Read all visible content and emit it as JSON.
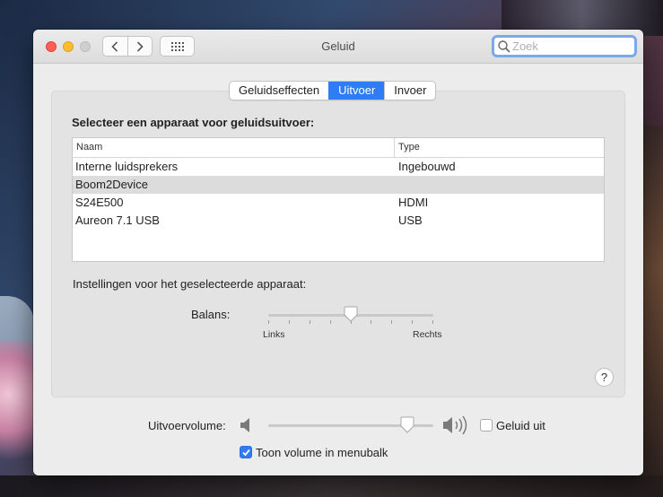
{
  "window": {
    "title": "Geluid"
  },
  "search": {
    "placeholder": "Zoek",
    "value": ""
  },
  "tabs": [
    {
      "label": "Geluidseffecten",
      "active": false
    },
    {
      "label": "Uitvoer",
      "active": true
    },
    {
      "label": "Invoer",
      "active": false
    }
  ],
  "output": {
    "heading": "Selecteer een apparaat voor geluidsuitvoer:",
    "columns": {
      "name": "Naam",
      "type": "Type"
    },
    "devices": [
      {
        "name": "Interne luidsprekers",
        "type": "Ingebouwd",
        "selected": false
      },
      {
        "name": "Boom2Device",
        "type": "",
        "selected": true
      },
      {
        "name": "S24E500",
        "type": "HDMI",
        "selected": false
      },
      {
        "name": "Aureon 7.1 USB",
        "type": "USB",
        "selected": false
      }
    ],
    "settings_label": "Instellingen voor het geselecteerde apparaat:",
    "balance": {
      "label": "Balans:",
      "left": "Links",
      "right": "Rechts",
      "value": 0.5
    }
  },
  "help": {
    "label": "?"
  },
  "volume": {
    "label": "Uitvoervolume:",
    "level": 0.84,
    "mute_label": "Geluid uit",
    "mute_checked": false,
    "menubar_label": "Toon volume in menubalk",
    "menubar_checked": true
  },
  "colors": {
    "accent": "#2f7cf6",
    "close": "#fe5f57",
    "minimize": "#febc2e"
  },
  "icons": {
    "back": "chevron-left-icon",
    "forward": "chevron-right-icon",
    "grid": "grid-icon",
    "search": "search-icon",
    "speaker_low": "speaker-low-icon",
    "speaker_high": "speaker-high-icon"
  }
}
